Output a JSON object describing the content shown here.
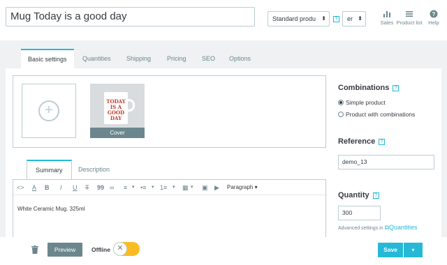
{
  "header": {
    "product_name": "Mug Today is a good day",
    "product_type": "Standard produ",
    "language": "er",
    "help_mark": "?",
    "tools": [
      {
        "label": "Sales",
        "icon": "bar-chart-icon"
      },
      {
        "label": "Product list",
        "icon": "list-icon"
      },
      {
        "label": "Help",
        "icon": "help-circle-icon"
      }
    ]
  },
  "tabs": [
    "Basic settings",
    "Quantities",
    "Shipping",
    "Pricing",
    "SEO",
    "Options"
  ],
  "media": {
    "add_symbol": "+",
    "cover_label": "Cover",
    "mug_text": "TODAY IS A GOOD DAY"
  },
  "editor": {
    "tabs": [
      "Summary",
      "Description"
    ],
    "toolbar": [
      "<>",
      "A",
      "B",
      "I",
      "U",
      "T",
      "99",
      "∞",
      "≡",
      "▾",
      "•≡",
      "▾",
      "1≡",
      "▾",
      "▦",
      "▾",
      "▣",
      "▶",
      "Paragraph ▾"
    ],
    "content": "White Ceramic Mug. 325ml"
  },
  "combinations": {
    "title": "Combinations",
    "options": [
      {
        "label": "Simple product",
        "checked": true
      },
      {
        "label": "Product with combinations",
        "checked": false
      }
    ]
  },
  "reference": {
    "title": "Reference",
    "value": "demo_13"
  },
  "quantity": {
    "title": "Quantity",
    "value": "300",
    "advanced_prefix": "Advanced settings in",
    "advanced_link": "Quantities"
  },
  "footer": {
    "preview": "Preview",
    "offline": "Offline",
    "toggle_symbol": "✕",
    "save": "Save",
    "dropdown": "▾"
  },
  "colors": {
    "accent": "#25b9d7",
    "toggle": "#fbbb22",
    "preview_bg": "#6c868e"
  }
}
